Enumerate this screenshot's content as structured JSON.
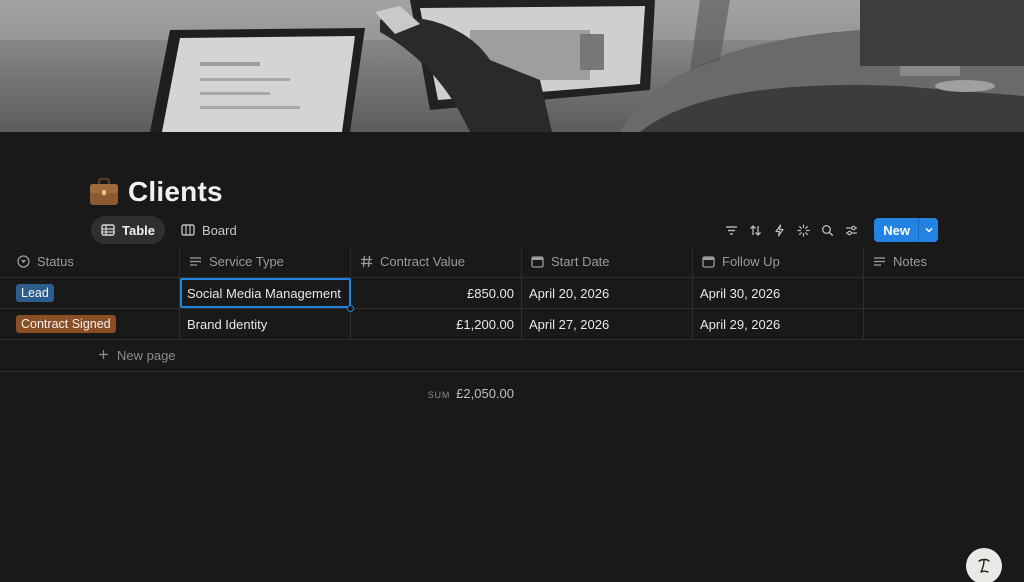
{
  "page": {
    "title": "Clients",
    "icon": "briefcase-icon"
  },
  "views": [
    {
      "label": "Table",
      "icon": "table-icon",
      "active": true
    },
    {
      "label": "Board",
      "icon": "board-icon",
      "active": false
    }
  ],
  "toolbar": {
    "icons": [
      "filter-icon",
      "sort-icon",
      "automation-icon",
      "ai-sparkle-icon",
      "search-icon",
      "settings-sliders-icon"
    ],
    "new_label": "New"
  },
  "table": {
    "columns": [
      {
        "label": "Status",
        "icon": "status-icon"
      },
      {
        "label": "Service Type",
        "icon": "text-icon"
      },
      {
        "label": "Contract Value",
        "icon": "hash-icon"
      },
      {
        "label": "Start Date",
        "icon": "calendar-icon"
      },
      {
        "label": "Follow Up",
        "icon": "calendar-icon"
      },
      {
        "label": "Notes",
        "icon": "text-icon"
      }
    ],
    "rows": [
      {
        "status": "Lead",
        "status_color": "#2d5d8c",
        "service": "Social Media Management",
        "value": "£850.00",
        "start": "April 20, 2026",
        "follow_up": "April 30, 2026",
        "notes": ""
      },
      {
        "status": "Contract Signed",
        "status_color": "#8a4d24",
        "service": "Brand Identity",
        "value": "£1,200.00",
        "start": "April 27, 2026",
        "follow_up": "April 29, 2026",
        "notes": ""
      }
    ],
    "new_page_label": "New page",
    "sum_label": "SUM",
    "sum_value": "£2,050.00"
  },
  "help": {
    "icon": "help-icon"
  },
  "colors": {
    "accent": "#2383e2",
    "background": "#191919"
  }
}
